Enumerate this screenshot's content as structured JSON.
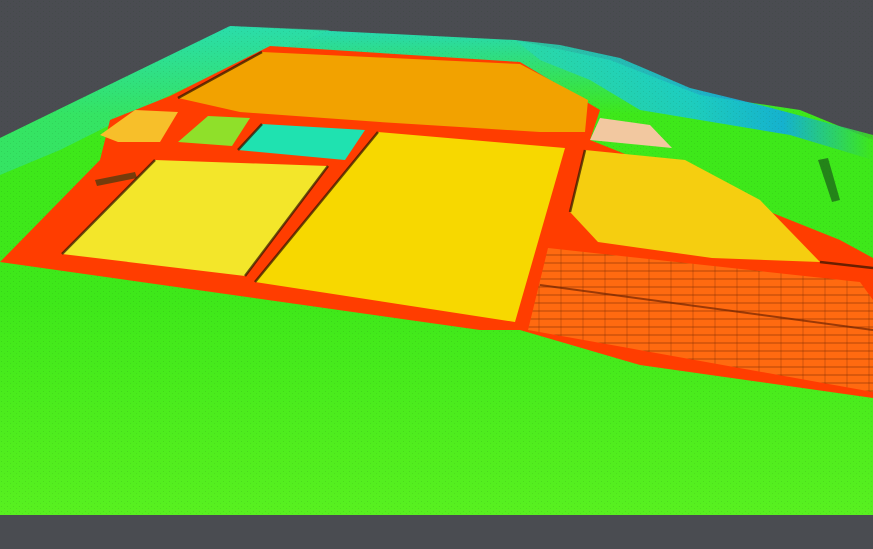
{
  "view": {
    "background": "#4a4c51",
    "colormap": [
      "#0a8fe8",
      "#18d2c4",
      "#3ee81a",
      "#9fe814",
      "#f5e800",
      "#f7c500",
      "#f29a00",
      "#ff6a00",
      "#ff3d00"
    ]
  },
  "terrain": {
    "base_color": "#3ee81a",
    "high_ground_color": "#1fd2d2"
  },
  "regions": [
    {
      "id": "large-top-basin",
      "color": "#f2a200"
    },
    {
      "id": "left-small-basin",
      "color": "#f7bf2a"
    },
    {
      "id": "small-green-basin",
      "color": "#8fe02a"
    },
    {
      "id": "small-teal-basin",
      "color": "#1fe2b0"
    },
    {
      "id": "left-yellow-basin",
      "color": "#f3e62a"
    },
    {
      "id": "central-yellow-basin",
      "color": "#f7d800"
    },
    {
      "id": "right-yellow-basin",
      "color": "#f5ce10"
    },
    {
      "id": "right-plot-strips",
      "color": "#ff6a10"
    },
    {
      "id": "strip-top-right",
      "color": "#f2c8a0"
    }
  ],
  "embankment_color": "#ff3d00"
}
